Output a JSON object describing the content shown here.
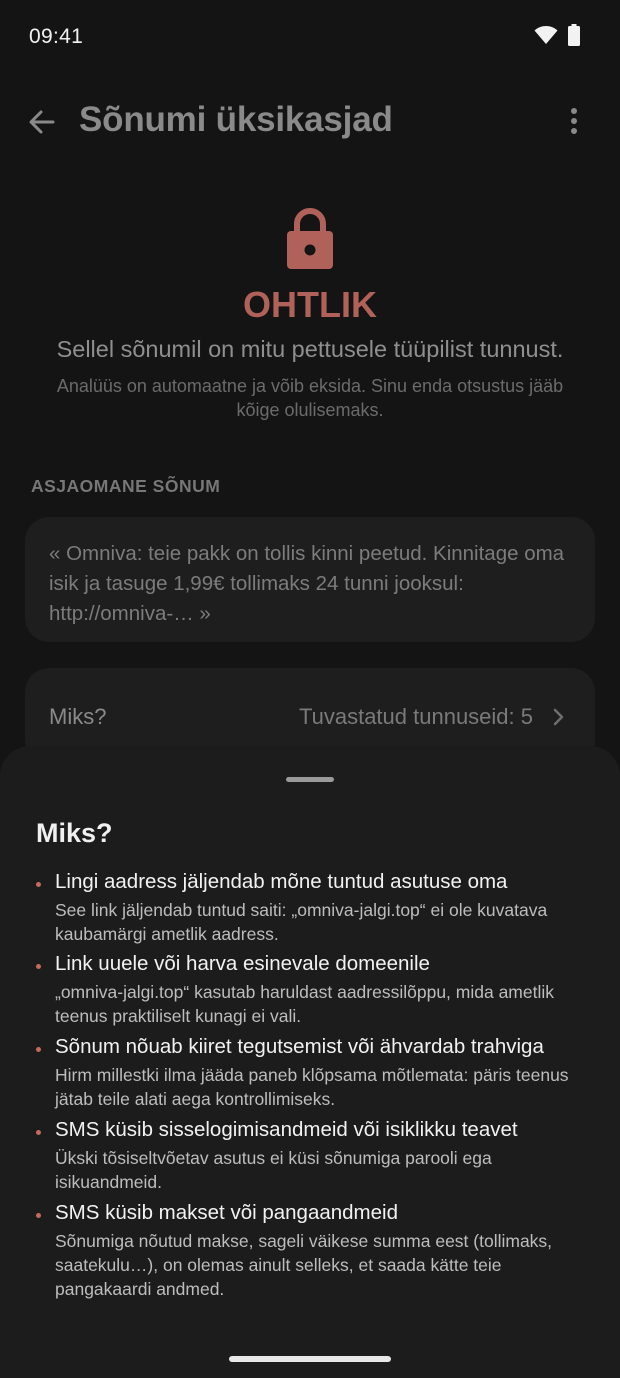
{
  "status_bar": {
    "time": "09:41"
  },
  "app_bar": {
    "title": "Sõnumi üksikasjad"
  },
  "verdict": {
    "label": "OHTLIK",
    "summary": "Sellel sõnumil on mitu pettusele tüüpilist tunnust.",
    "disclaimer": "Analüüs on automaatne ja võib eksida. Sinu enda otsustus jääb kõige olulisemaks."
  },
  "message": {
    "section_label": "ASJAOMANE SÕNUM",
    "text": "« Omniva: teie pakk on tollis kinni peetud. Kinnitage oma isik ja tasuge 1,99€ tollimaks 24 tunni jooksul: http://omniva-… »"
  },
  "why_row": {
    "label": "Miks?",
    "count_text": "Tuvastatud tunnuseid: 5"
  },
  "sheet": {
    "title": "Miks?",
    "reasons": [
      {
        "title": "Lingi aadress jäljendab mõne tuntud asutuse oma",
        "desc": "See link jäljendab tuntud saiti: „omniva-jalgi.top“ ei ole kuvatava kaubamärgi ametlik aadress."
      },
      {
        "title": "Link uuele või harva esinevale domeenile",
        "desc": "„omniva-jalgi.top“ kasutab haruldast aadressilõppu, mida ametlik teenus praktiliselt kunagi ei vali."
      },
      {
        "title": "Sõnum nõuab kiiret tegutsemist või ähvardab trahviga",
        "desc": "Hirm millestki ilma jääda paneb klõpsama mõtlemata: päris teenus jätab teile alati aega kontrollimiseks."
      },
      {
        "title": "SMS küsib sisselogimisandmeid või isiklikku teavet",
        "desc": "Ükski tõsiseltvõetav asutus ei küsi sõnumiga parooli ega isikuandmeid."
      },
      {
        "title": "SMS küsib makset või pangaandmeid",
        "desc": "Sõnumiga nõutud makse, sageli väikese summa eest (tollimaks, saatekulu…), on olemas ainult selleks, et saada kätte teie pangakaardi andmed."
      }
    ]
  },
  "colors": {
    "danger": "#b0615a",
    "bullet": "#c46a5e",
    "background": "#141414",
    "card": "#1e1e1e",
    "sheet": "#1c1c1c"
  }
}
